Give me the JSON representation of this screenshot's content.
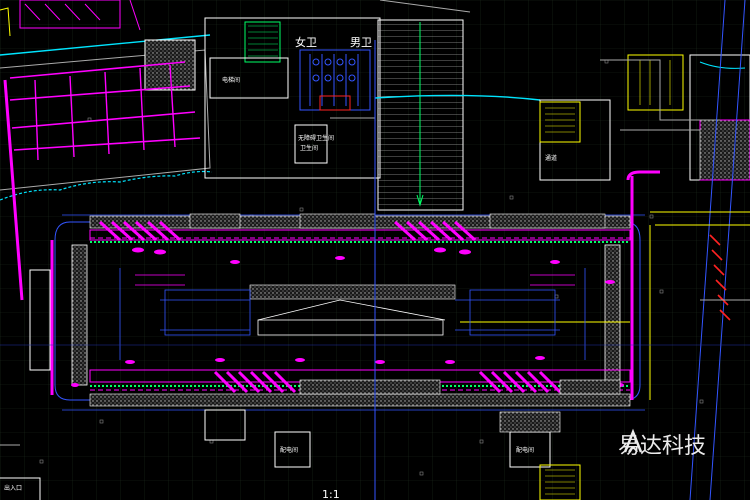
{
  "labels": {
    "women_wc": "女卫",
    "men_wc": "男卫",
    "room_1": "电梯间",
    "room_2": "无障碍卫生间",
    "room_3": "卫生间",
    "room_4": "配电间",
    "room_5": "通道",
    "room_6": "配电间",
    "scale": "1:1",
    "corner": "出入口"
  },
  "watermark": {
    "text": "易达科技",
    "logo": "yida-logo-icon"
  },
  "colors": {
    "bg": "#000000",
    "white": "#ffffff",
    "cyan": "#00e5ff",
    "magenta": "#ff00ff",
    "blue": "#2244ff",
    "yellow": "#ffff00",
    "green": "#00ff66",
    "red": "#ff2222",
    "gray": "#9a9a9a"
  }
}
